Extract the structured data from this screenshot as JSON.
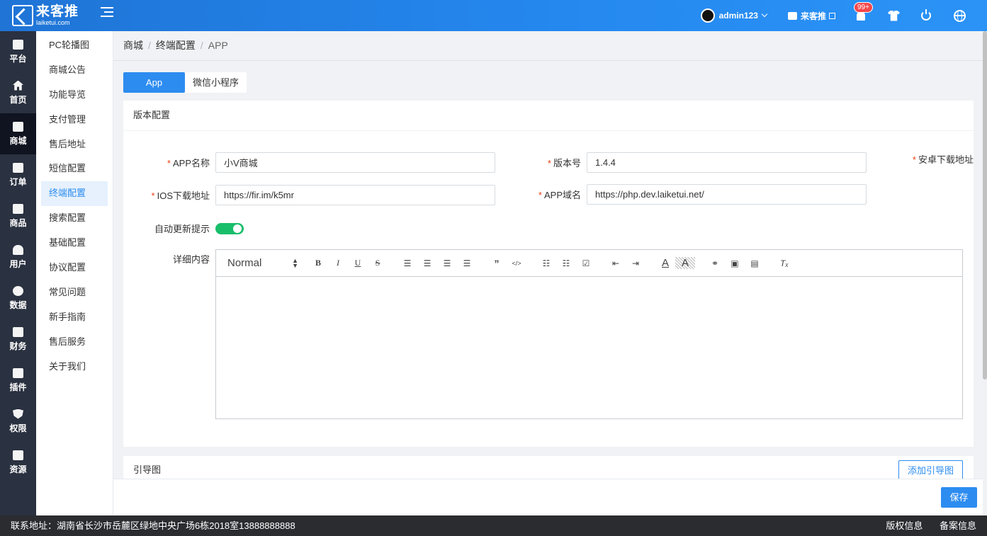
{
  "header": {
    "logo_name": "来客推",
    "logo_sub": "laiketui.com",
    "username": "admin123",
    "store_name": "来客推",
    "notification_badge": "99+"
  },
  "rail": [
    {
      "label": "平台",
      "icon": "platform-icon"
    },
    {
      "label": "首页",
      "icon": "home-icon"
    },
    {
      "label": "商城",
      "icon": "store-icon",
      "active": true
    },
    {
      "label": "订单",
      "icon": "order-icon"
    },
    {
      "label": "商品",
      "icon": "goods-icon"
    },
    {
      "label": "用户",
      "icon": "user-icon"
    },
    {
      "label": "数据",
      "icon": "pie-chart-icon"
    },
    {
      "label": "财务",
      "icon": "wallet-icon"
    },
    {
      "label": "插件",
      "icon": "puzzle-icon"
    },
    {
      "label": "权限",
      "icon": "shield-icon"
    },
    {
      "label": "资源",
      "icon": "image-icon"
    }
  ],
  "submenu": [
    {
      "label": "PC轮播图"
    },
    {
      "label": "商城公告"
    },
    {
      "label": "功能导览"
    },
    {
      "label": "支付管理"
    },
    {
      "label": "售后地址"
    },
    {
      "label": "短信配置"
    },
    {
      "label": "终端配置",
      "active": true
    },
    {
      "label": "搜索配置"
    },
    {
      "label": "基础配置"
    },
    {
      "label": "协议配置"
    },
    {
      "label": "常见问题"
    },
    {
      "label": "新手指南"
    },
    {
      "label": "售后服务"
    },
    {
      "label": "关于我们"
    }
  ],
  "breadcrumb": [
    "商城",
    "终端配置",
    "APP"
  ],
  "tabs": {
    "app": "App",
    "wechat": "微信小程序"
  },
  "version_card": {
    "title": "版本配置",
    "app_name_label": "APP名称",
    "app_name_value": "小V商城",
    "version_label": "版本号",
    "version_value": "1.4.4",
    "android_label": "安卓下载地址",
    "ios_label": "IOS下载地址",
    "ios_value": "https://fir.im/k5mr",
    "domain_label": "APP域名",
    "domain_value": "https://php.dev.laiketui.net/",
    "auto_update_label": "自动更新提示",
    "auto_update_on": true,
    "detail_label": "详细内容",
    "editor_font_size": "Normal"
  },
  "guide_card": {
    "title": "引导图",
    "add_button": "添加引导图"
  },
  "save_button": "保存",
  "footer": {
    "address": "联系地址：湖南省长沙市岳麓区绿地中央广场6栋2018室13888888888",
    "copyright": "版权信息",
    "record": "备案信息"
  },
  "colors": {
    "primary": "#2d8cf0",
    "header": "#2589f0",
    "rail_bg": "#2a3140",
    "switch_on": "#19be6b",
    "required": "#ed4014"
  }
}
